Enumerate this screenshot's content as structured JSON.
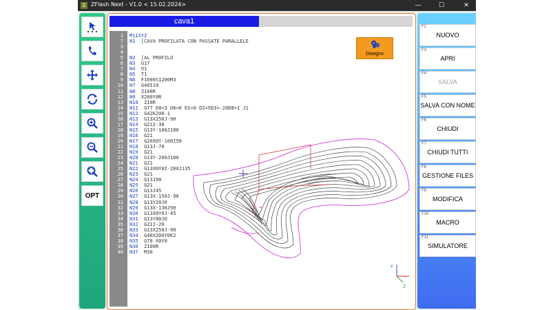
{
  "window": {
    "title": "ZFlash Next - V1.0 < 15.02.2024>",
    "minimize": "—",
    "maximize": "☐",
    "close": "✕"
  },
  "left_toolbar": {
    "opt_label": "OPT",
    "icons": [
      "pointer-icon",
      "phone-icon",
      "move-icon",
      "rotate-icon",
      "zoom-in-icon",
      "zoom-out-icon",
      "zoom-fit-icon"
    ]
  },
  "editor": {
    "tab": "cava1",
    "line_numbers": [
      "1",
      "7",
      "",
      "3",
      "",
      "",
      "",
      "",
      "",
      "",
      "",
      "",
      "",
      "",
      "",
      "",
      "",
      "",
      "",
      "",
      "",
      "",
      "",
      "",
      "",
      "",
      "",
      "",
      "",
      "",
      "",
      "",
      "",
      "",
      "",
      "",
      "",
      "",
      "",
      "",
      ""
    ],
    "lines": [
      {
        "ln": "1",
        "text": "M11XYZ"
      },
      {
        "ln": "7",
        "text": "N1  [CAVA PROFILATA CON PASSATE PARALLELE"
      },
      {
        "ln": "3",
        "text": ""
      },
      {
        "ln": "4",
        "text": ""
      },
      {
        "ln": "5",
        "text": "N2  [AL PROFILO"
      },
      {
        "ln": "6",
        "text": "N3  G17"
      },
      {
        "ln": "7",
        "text": "N4  O1"
      },
      {
        "ln": "8",
        "text": "N5  T1"
      },
      {
        "ln": "9",
        "text": "N6  F1000S1200M3"
      },
      {
        "ln": "10",
        "text": "N7  G40I10"
      },
      {
        "ln": "11",
        "text": "N8  Z100R"
      },
      {
        "ln": "12",
        "text": "N9  X200Y0R"
      },
      {
        "ln": "13",
        "text": "N10  Z10R"
      },
      {
        "ln": "14",
        "text": "N11  G77 D0=3 D6=0 D1=0 D2=5D3=-20D8=1 J1"
      },
      {
        "ln": "15",
        "text": "N12  G42K200-1"
      },
      {
        "ln": "16",
        "text": "N13  G13X250J-90"
      },
      {
        "ln": "17",
        "text": "N14  G21I-30"
      },
      {
        "ln": "18",
        "text": "N15  G13Y-100J180"
      },
      {
        "ln": "19",
        "text": "N16  G21"
      },
      {
        "ln": "20",
        "text": "N17  G20X0Y-100I50"
      },
      {
        "ln": "21",
        "text": "N18  G13J-70"
      },
      {
        "ln": "22",
        "text": "N19  G21"
      },
      {
        "ln": "23",
        "text": "N20  G13Y-200J180"
      },
      {
        "ln": "24",
        "text": "N21  G21"
      },
      {
        "ln": "25",
        "text": "N22  G13X0Y0I-200J135"
      },
      {
        "ln": "26",
        "text": "N23  G21"
      },
      {
        "ln": "27",
        "text": "N24  G13J90"
      },
      {
        "ln": "28",
        "text": "N25  G21"
      },
      {
        "ln": "29",
        "text": "N26  G13J45"
      },
      {
        "ln": "30",
        "text": "N27  G13X-150J-90"
      },
      {
        "ln": "31",
        "text": "N28  G13Y20J0"
      },
      {
        "ln": "32",
        "text": "N29  G13X-130J90"
      },
      {
        "ln": "33",
        "text": "N30  G13X0Y0J-45"
      },
      {
        "ln": "34",
        "text": "N31  G13Y80J0"
      },
      {
        "ln": "35",
        "text": "N32  G21I-20"
      },
      {
        "ln": "36",
        "text": "N33  G13X250J-90"
      },
      {
        "ln": "37",
        "text": "N34  G40X200Y0K2"
      },
      {
        "ln": "38",
        "text": "N35  G78 X0Y0"
      },
      {
        "ln": "39",
        "text": "N36  Z100R"
      },
      {
        "ln": "40",
        "text": "N37  M30"
      }
    ],
    "draw_button": "Disegno",
    "axes": {
      "x": "X",
      "y": "Y",
      "z": "Z"
    }
  },
  "right_toolbar": {
    "buttons": [
      {
        "fkey": "F2",
        "label": "NUOVO",
        "enabled": true
      },
      {
        "fkey": "F3",
        "label": "APRI",
        "enabled": true
      },
      {
        "fkey": "F4",
        "label": "SALVA",
        "enabled": false
      },
      {
        "fkey": "F5",
        "label": "SALVA CON NOME",
        "enabled": true
      },
      {
        "fkey": "F6",
        "label": "CHIUDI",
        "enabled": true
      },
      {
        "fkey": "F7",
        "label": "CHIUDI TUTTI",
        "enabled": true
      },
      {
        "fkey": "F8",
        "label": "GESTIONE FILES",
        "enabled": true
      },
      {
        "fkey": "F9",
        "label": "MODIFICA",
        "enabled": true
      },
      {
        "fkey": "F10",
        "label": "MACRO",
        "enabled": true
      },
      {
        "fkey": "F11",
        "label": "SIMULATORE",
        "enabled": true
      }
    ]
  },
  "colors": {
    "tab_active": "#1a1ce6",
    "left_toolbar": "#2fc98b",
    "right_toolbar": "#3f6cf0",
    "editor_border": "#e07a2c",
    "draw_button": "#f39a1f",
    "path_magenta": "#d01fd0",
    "path_red": "#d02020"
  }
}
